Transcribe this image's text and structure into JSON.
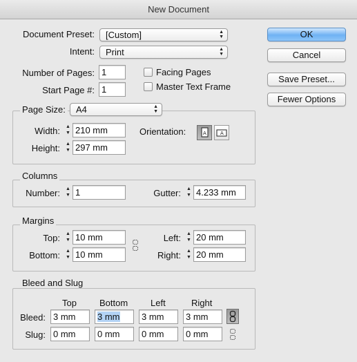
{
  "window": {
    "title": "New Document"
  },
  "preset": {
    "label": "Document Preset:",
    "value": "[Custom]"
  },
  "intent": {
    "label": "Intent:",
    "value": "Print"
  },
  "pages": {
    "count_label": "Number of Pages:",
    "count_value": "1",
    "start_label": "Start Page #:",
    "start_value": "1",
    "facing_label": "Facing Pages",
    "master_label": "Master Text Frame"
  },
  "buttons": {
    "ok": "OK",
    "cancel": "Cancel",
    "save_preset": "Save Preset...",
    "fewer_options": "Fewer Options"
  },
  "page_size": {
    "label": "Page Size:",
    "value": "A4",
    "width_label": "Width:",
    "width_value": "210 mm",
    "height_label": "Height:",
    "height_value": "297 mm",
    "orientation_label": "Orientation:"
  },
  "columns": {
    "title": "Columns",
    "number_label": "Number:",
    "number_value": "1",
    "gutter_label": "Gutter:",
    "gutter_value": "4.233 mm"
  },
  "margins": {
    "title": "Margins",
    "top_label": "Top:",
    "top_value": "10 mm",
    "bottom_label": "Bottom:",
    "bottom_value": "10 mm",
    "left_label": "Left:",
    "left_value": "20 mm",
    "right_label": "Right:",
    "right_value": "20 mm"
  },
  "bleed_slug": {
    "title": "Bleed and Slug",
    "headers": [
      "Top",
      "Bottom",
      "Left",
      "Right"
    ],
    "bleed_label": "Bleed:",
    "bleed_values": [
      "3 mm",
      "3 mm",
      "3 mm",
      "3 mm"
    ],
    "slug_label": "Slug:",
    "slug_values": [
      "0 mm",
      "0 mm",
      "0 mm",
      "0 mm"
    ]
  }
}
